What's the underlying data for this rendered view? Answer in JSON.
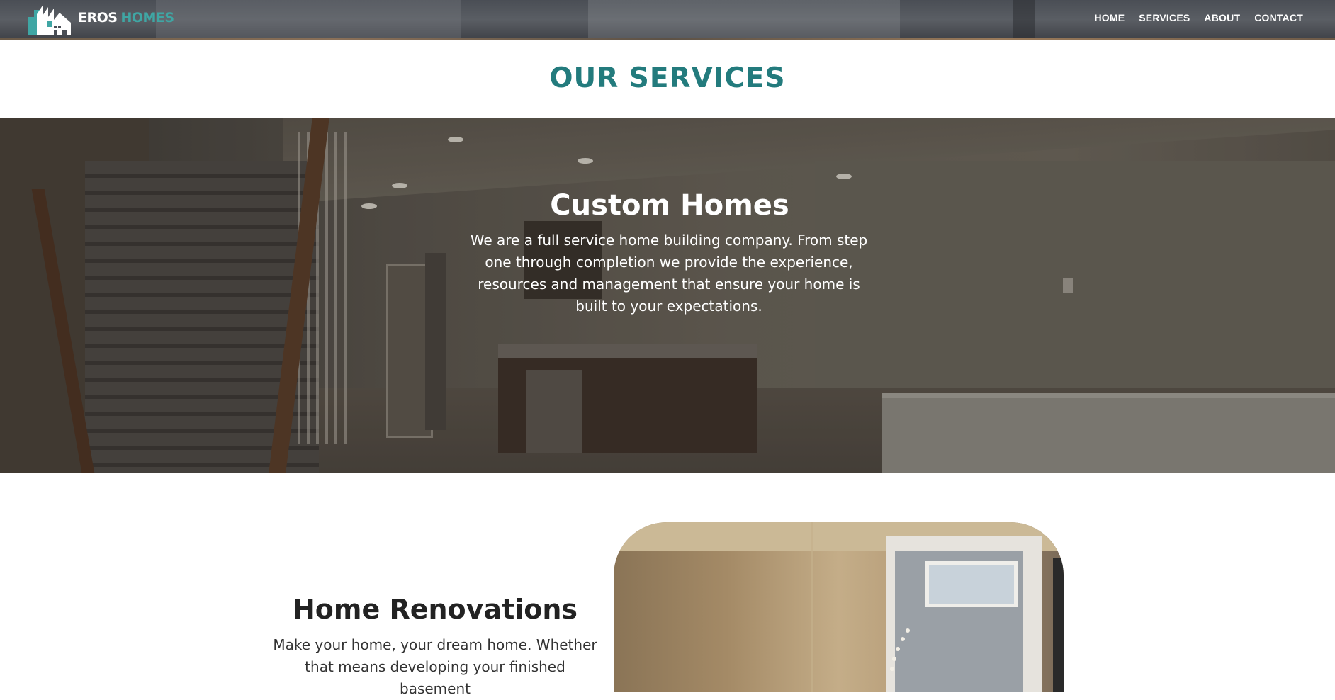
{
  "header": {
    "brand_word1": "EROS",
    "brand_word2": "HOMES",
    "nav": [
      "HOME",
      "SERVICES",
      "ABOUT",
      "CONTACT"
    ]
  },
  "services_section": {
    "title": "OUR SERVICES"
  },
  "custom_homes": {
    "title": "Custom Homes",
    "text": "We are a full service home building company. From step one through completion we provide the experience, resources and management that ensure your home is built to your expectations."
  },
  "renovations": {
    "title": "Home Renovations",
    "text": "Make your home, your dream home. Whether that means developing your finished basement"
  },
  "colors": {
    "accent": "#237b7d",
    "brand_accent": "#3fa6a4"
  },
  "icons": {
    "logo": "house-buildings-logo-icon"
  }
}
